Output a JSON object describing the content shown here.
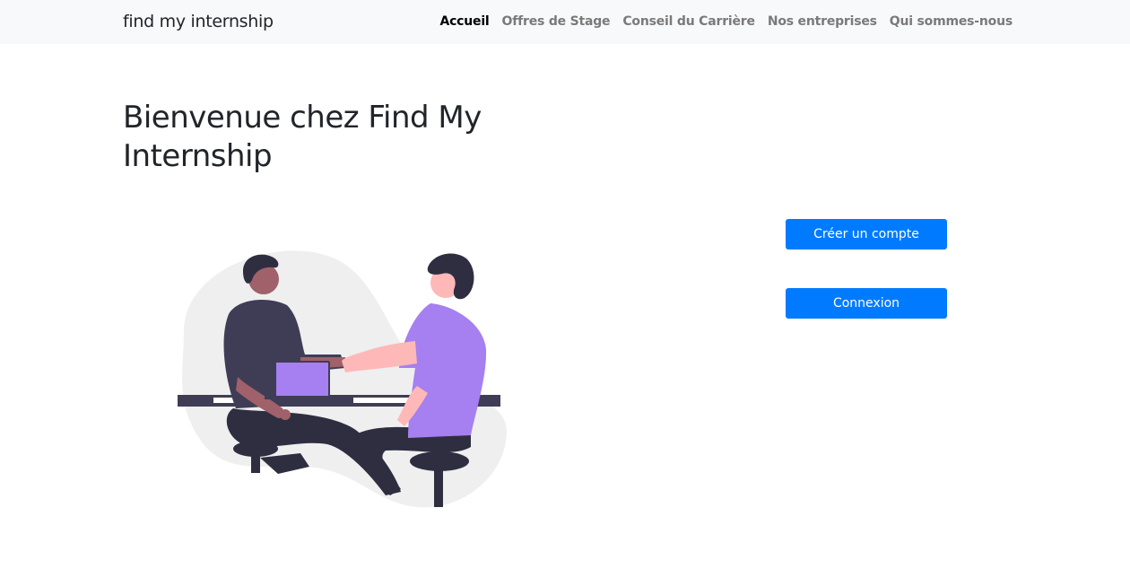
{
  "navbar": {
    "brand": "find my internship",
    "links": [
      {
        "label": "Accueil",
        "active": true
      },
      {
        "label": "Offres de Stage",
        "active": false
      },
      {
        "label": "Conseil du Carrière",
        "active": false
      },
      {
        "label": "Nos entreprises",
        "active": false
      },
      {
        "label": "Qui sommes-nous",
        "active": false
      }
    ]
  },
  "hero": {
    "title": "Bienvenue chez Find My Internship",
    "illustration": "handshake-illustration"
  },
  "actions": {
    "create_account_label": "Créer un compte",
    "login_label": "Connexion"
  },
  "colors": {
    "primary": "#007bff",
    "navbar_bg": "#f8f9fa",
    "accent_purple": "#a67ff0",
    "dark": "#2f2e41"
  }
}
